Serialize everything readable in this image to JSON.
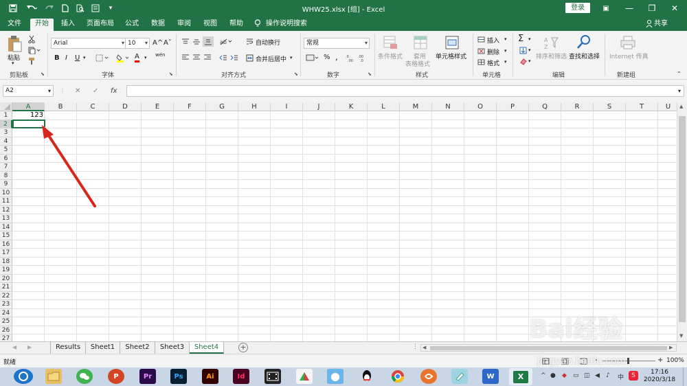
{
  "window": {
    "title": "WHW25.xlsx [组] - Excel",
    "login": "登录",
    "controls": {
      "ribbon_options": "▣",
      "minimize": "—",
      "restore": "❐",
      "close": "✕"
    }
  },
  "tabs": [
    "文件",
    "开始",
    "插入",
    "页面布局",
    "公式",
    "数据",
    "审阅",
    "视图",
    "帮助"
  ],
  "active_tab": "开始",
  "tell_me": "操作说明搜索",
  "share": "共享",
  "ribbon": {
    "clipboard": {
      "label": "剪贴板",
      "paste": "粘贴"
    },
    "font": {
      "label": "字体",
      "name": "Arial",
      "size": "10",
      "bold": "B",
      "italic": "I",
      "underline": "U",
      "grow": "A^",
      "shrink": "Aˇ",
      "font_color": "A",
      "wen": "wén"
    },
    "alignment": {
      "label": "对齐方式",
      "wrap": "自动换行",
      "merge": "合并后居中"
    },
    "number": {
      "label": "数字",
      "format": "常规",
      "percent": "%",
      "comma": ","
    },
    "styles": {
      "label": "样式",
      "conditional": "条件格式",
      "table_line1": "套用",
      "table_line2": "表格格式",
      "cell_styles": "单元格样式"
    },
    "cells": {
      "label": "单元格",
      "insert": "插入",
      "delete": "删除",
      "format": "格式"
    },
    "editing": {
      "label": "编辑",
      "sort_filter": "排序和筛选",
      "find_select": "查找和选择"
    },
    "newgroup": {
      "label": "新建组",
      "internet_fax": "Internet 传真"
    }
  },
  "formula_bar": {
    "name_box": "A2",
    "cancel": "✕",
    "enter": "✓",
    "fx": "fx",
    "value": ""
  },
  "grid": {
    "columns": [
      "A",
      "B",
      "C",
      "D",
      "E",
      "F",
      "G",
      "H",
      "I",
      "J",
      "K",
      "L",
      "M",
      "N",
      "O",
      "P",
      "Q",
      "R",
      "S",
      "T",
      "U"
    ],
    "rows": [
      "1",
      "2",
      "3",
      "4",
      "5",
      "6",
      "7",
      "8",
      "9",
      "10",
      "11",
      "12",
      "13",
      "14",
      "15",
      "16",
      "17",
      "18",
      "19",
      "20",
      "21",
      "22",
      "23",
      "24",
      "25",
      "26",
      "27"
    ],
    "selected_column": "A",
    "selected_row": "2",
    "cells": {
      "A1": "123"
    }
  },
  "sheets": [
    "Results",
    "Sheet1",
    "Sheet2",
    "Sheet3",
    "Sheet4"
  ],
  "active_sheet": "Sheet4",
  "add_sheet": "+",
  "status": {
    "ready": "就绪",
    "zoom": "100%",
    "zoom_minus": "-",
    "zoom_plus": "+"
  },
  "watermark": {
    "brand": "Bai经验",
    "url": "jingyan.baidu.com"
  },
  "taskbar": {
    "apps": [
      "Pr",
      "Ps",
      "Ai",
      "Id",
      "W",
      "X"
    ],
    "tray": {
      "ime": "中",
      "time": "17:16",
      "date": "2020/3/18"
    }
  },
  "colors": {
    "accent": "#217346",
    "arrow": "#d9261c",
    "taskbar": "#c8d6e6"
  }
}
